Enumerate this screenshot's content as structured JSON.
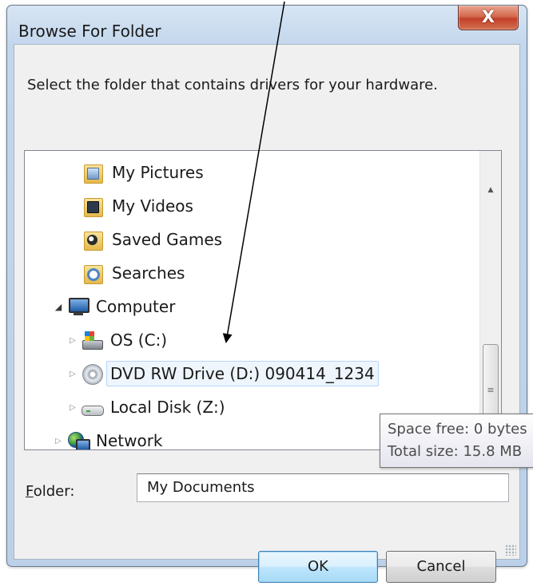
{
  "dialog": {
    "title": "Browse For Folder",
    "close_glyph": "X",
    "instruction": "Select the folder that contains drivers for your hardware."
  },
  "tree": {
    "items": [
      {
        "label": "My Pictures",
        "icon": "pictures-folder-icon",
        "expander": ""
      },
      {
        "label": "My Videos",
        "icon": "videos-folder-icon",
        "expander": ""
      },
      {
        "label": "Saved Games",
        "icon": "saved-games-folder-icon",
        "expander": ""
      },
      {
        "label": "Searches",
        "icon": "searches-folder-icon",
        "expander": ""
      },
      {
        "label": "Computer",
        "icon": "computer-icon",
        "expander": "expanded"
      },
      {
        "label": "OS (C:)",
        "icon": "os-drive-icon",
        "expander": "collapsed"
      },
      {
        "label": "DVD RW Drive (D:) 090414_1234",
        "icon": "dvd-drive-icon",
        "expander": "collapsed",
        "selected": true
      },
      {
        "label": "Local Disk (Z:)",
        "icon": "local-disk-icon",
        "expander": "collapsed"
      },
      {
        "label": "Network",
        "icon": "network-icon",
        "expander": "collapsed"
      }
    ],
    "scrollbar_grip": "≡"
  },
  "tooltip": {
    "line1": "Space free: 0 bytes",
    "line2": "Total size: 15.8 MB"
  },
  "folder_field": {
    "label_accel": "F",
    "label_rest": "older:",
    "value": "My Documents"
  },
  "buttons": {
    "ok": "OK",
    "cancel": "Cancel"
  },
  "colors": {
    "frame": "#c2d6ec",
    "close_button": "#c2402a",
    "selection_border": "#b8d6fb",
    "ok_button": "#bee6fd"
  }
}
